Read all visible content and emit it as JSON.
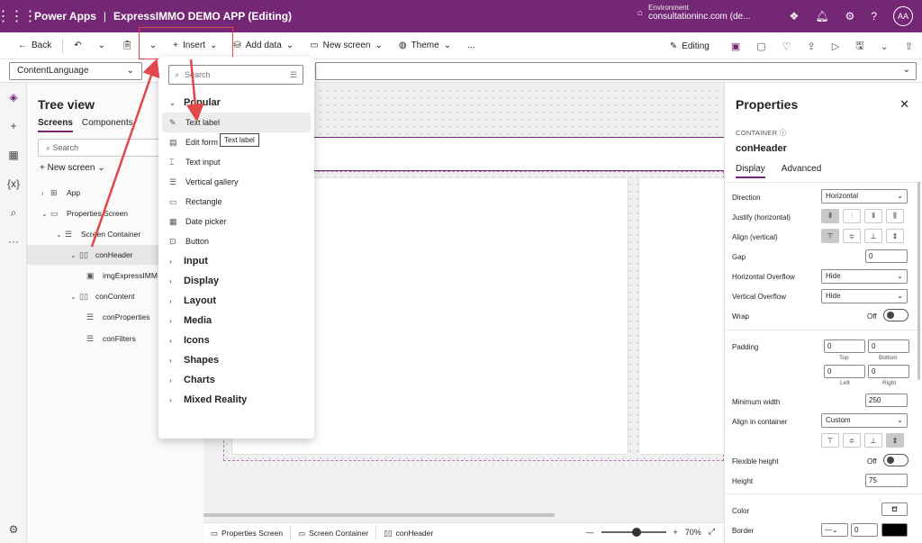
{
  "titlebar": {
    "app_name": "Power Apps",
    "separator": "|",
    "app_title": "ExpressIMMO DEMO APP (Editing)",
    "env_label": "Environment",
    "env_value": "consultationinc.com (de...",
    "avatar": "AA"
  },
  "commandbar": {
    "back": "Back",
    "insert": "Insert",
    "add_data": "Add data",
    "new_screen": "New screen",
    "theme": "Theme",
    "more": "...",
    "editing": "Editing"
  },
  "formulabar": {
    "property": "ContentLanguage"
  },
  "tree": {
    "title": "Tree view",
    "tab_screens": "Screens",
    "tab_components": "Components",
    "search_placeholder": "Search",
    "new_screen": "New screen",
    "items": [
      {
        "label": "App",
        "icon": "app-icon"
      },
      {
        "label": "Properties Screen",
        "icon": "screen-icon"
      },
      {
        "label": "Screen Container",
        "icon": "container-icon"
      },
      {
        "label": "conHeader",
        "icon": "horizontal-container-icon"
      },
      {
        "label": "imgExpressIMM",
        "icon": "image-icon"
      },
      {
        "label": "conContent",
        "icon": "horizontal-container-icon"
      },
      {
        "label": "conProperties",
        "icon": "container-icon"
      },
      {
        "label": "conFilters",
        "icon": "container-icon"
      }
    ]
  },
  "insert_menu": {
    "search_placeholder": "Search",
    "popular": "Popular",
    "items": [
      "Text label",
      "Edit form",
      "Text input",
      "Vertical gallery",
      "Rectangle",
      "Date picker",
      "Button"
    ],
    "categories": [
      "Input",
      "Display",
      "Layout",
      "Media",
      "Icons",
      "Shapes",
      "Charts",
      "Mixed Reality"
    ],
    "tooltip": "Text label"
  },
  "statusbar": {
    "crumbs": [
      "Properties Screen",
      "Screen Container",
      "conHeader"
    ],
    "zoom": "70%",
    "minus": "—",
    "plus": "+"
  },
  "properties": {
    "title": "Properties",
    "kind": "CONTAINER",
    "name": "conHeader",
    "tab_display": "Display",
    "tab_advanced": "Advanced",
    "direction_label": "Direction",
    "direction_value": "Horizontal",
    "justify_label": "Justify (horizontal)",
    "align_label": "Align (vertical)",
    "gap_label": "Gap",
    "gap_value": "0",
    "hoverflow_label": "Horizontal Overflow",
    "hoverflow_value": "Hide",
    "voverflow_label": "Vertical Overflow",
    "voverflow_value": "Hide",
    "wrap_label": "Wrap",
    "wrap_value": "Off",
    "padding_label": "Padding",
    "padding_top": "0",
    "padding_bottom": "0",
    "padding_left": "0",
    "padding_right": "0",
    "top": "Top",
    "bottom": "Bottom",
    "left": "Left",
    "right": "Right",
    "minwidth_label": "Minimum width",
    "minwidth_value": "250",
    "align_container_label": "Align in container",
    "align_container_value": "Custom",
    "flexheight_label": "Flexible height",
    "flexheight_value": "Off",
    "height_label": "Height",
    "height_value": "75",
    "color_label": "Color",
    "border_label": "Border",
    "border_width": "0"
  },
  "colors": {
    "brand": "#742774",
    "annotation": "#e0484b"
  }
}
